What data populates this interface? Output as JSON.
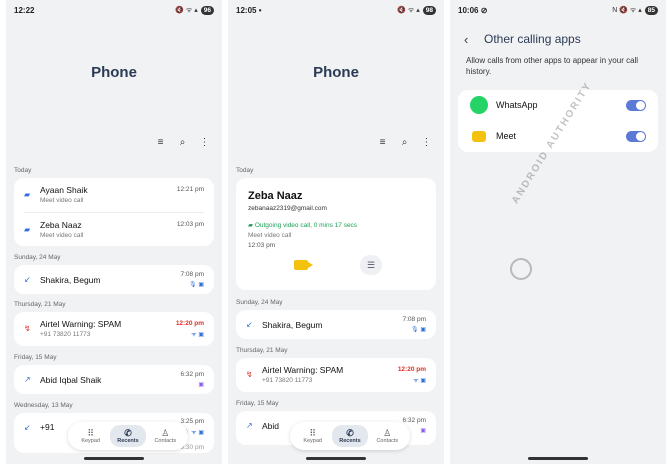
{
  "screen1": {
    "status": {
      "time": "12:22",
      "icons": "🔇 ᯤ ▴",
      "battery": "96"
    },
    "title": "Phone",
    "sections": {
      "today": "Today",
      "sun24": "Sunday, 24 May",
      "thu21": "Thursday, 21 May",
      "fri15": "Friday, 15 May",
      "wed13": "Wednesday, 13 May"
    },
    "today_calls": [
      {
        "name": "Ayaan Shaik",
        "sub": "Meet video call",
        "time": "12:21 pm"
      },
      {
        "name": "Zeba Naaz",
        "sub": "Meet video call",
        "time": "12:03 pm"
      }
    ],
    "call_shakira": {
      "name": "Shakira, Begum",
      "time": "7:08 pm"
    },
    "call_airtel": {
      "name": "Airtel Warning: SPAM",
      "sub": "+91 73820 11773",
      "time": "12:20 pm"
    },
    "call_abid": {
      "name": "Abid Iqbal Shaik",
      "time": "6:32 pm"
    },
    "call_partial": {
      "name": "+91",
      "time": "3:25 pm"
    },
    "call_partial2": {
      "time": "9:30 pm"
    },
    "nav": {
      "keypad": "Keypad",
      "recents": "Recents",
      "contacts": "Contacts"
    }
  },
  "screen2": {
    "status": {
      "time": "12:05",
      "dot": "•",
      "icons": "🔇 ᯤ ▴",
      "battery": "98"
    },
    "title": "Phone",
    "today": "Today",
    "expanded": {
      "name": "Zeba Naaz",
      "email": "zebanaaz2319@gmail.com",
      "outgoing": "Outgoing video call, 0 mins 17 secs",
      "sub": "Meet video call",
      "time": "12:03 pm"
    },
    "sections": {
      "sun24": "Sunday, 24 May",
      "thu21": "Thursday, 21 May",
      "fri15": "Friday, 15 May"
    },
    "call_shakira": {
      "name": "Shakira, Begum",
      "time": "7:08 pm"
    },
    "call_airtel": {
      "name": "Airtel Warning: SPAM",
      "sub": "+91 73820 11773",
      "time": "12:20 pm"
    },
    "call_abid": {
      "name": "Abid",
      "time": "6:32 pm"
    },
    "nav": {
      "keypad": "Keypad",
      "recents": "Recents",
      "contacts": "Contacts"
    }
  },
  "screen3": {
    "status": {
      "time": "10:06",
      "icons": "N 🔇 ᯤ ▴",
      "battery": "85"
    },
    "title": "Other calling apps",
    "description": "Allow calls from other apps to appear in your call history.",
    "apps": [
      {
        "name": "WhatsApp",
        "enabled": true
      },
      {
        "name": "Meet",
        "enabled": true
      }
    ],
    "watermark": "ANDROID AUTHORITY"
  },
  "colors": {
    "accent": "#2b3a55",
    "missed": "#d93025",
    "outgoing": "#1e9e57",
    "toggle": "#5b79d6",
    "whatsapp": "#25d366",
    "meet": "#f4c20d"
  }
}
